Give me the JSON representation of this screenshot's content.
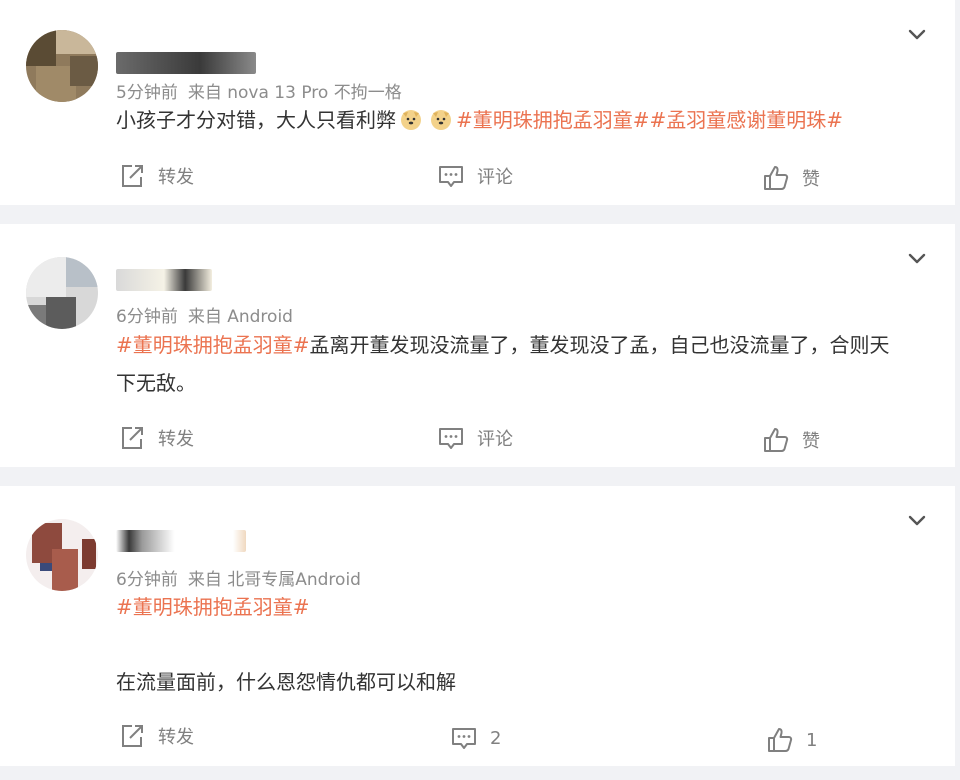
{
  "posts": [
    {
      "meta": {
        "time": "5分钟前",
        "source": "来自 nova 13 Pro 不拘一格"
      },
      "text_plain": "小孩子才分对错，大人只看利弊",
      "emoji": [
        "doge-emoji",
        "doge-emoji"
      ],
      "tags": [
        "#董明珠拥抱孟羽童#",
        "#孟羽童感谢董明珠#"
      ],
      "actions": {
        "repost": "转发",
        "comment": "评论",
        "like": "赞"
      }
    },
    {
      "meta": {
        "time": "6分钟前",
        "source": "来自 Android"
      },
      "tag": "#董明珠拥抱孟羽童#",
      "text_line1": "孟离开董发现没流量了，董发现没了孟，自己也没流量了，合则天",
      "text_line2": "下无敌。",
      "actions": {
        "repost": "转发",
        "comment": "评论",
        "like": "赞"
      }
    },
    {
      "meta": {
        "time": "6分钟前",
        "source": "来自 北哥专属Android"
      },
      "tag": "#董明珠拥抱孟羽童#",
      "text": "在流量面前，什么恩怨情仇都可以和解",
      "actions": {
        "repost": "转发",
        "comment": "2",
        "like": "1"
      }
    }
  ],
  "colors": {
    "tag": "#eb7350",
    "meta": "#8c8c8c",
    "action": "#808080",
    "background": "#f1f2f5"
  }
}
